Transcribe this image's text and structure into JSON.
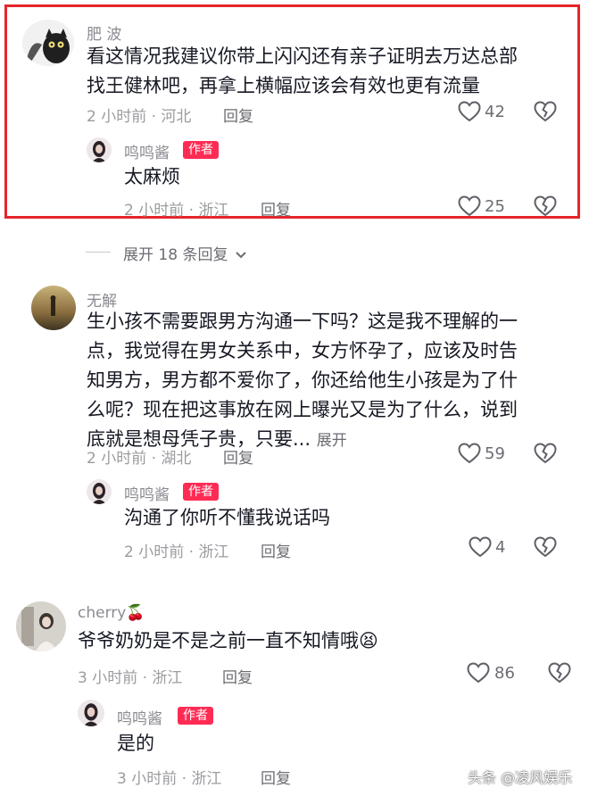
{
  "comments": [
    {
      "username": "肥 波",
      "lines": [
        "看这情况我建议你带上闪闪还有亲子证明去万达总部",
        "找王健林吧，再拿上横幅应该会有效也更有流量"
      ],
      "time_location": "2 小时前 · 河北",
      "reply_label": "回复",
      "likes": "42",
      "reply": {
        "username": "鸣鸣酱",
        "badge": "作者",
        "text": "太麻烦",
        "time_location": "2 小时前 · 浙江",
        "reply_label": "回复",
        "likes": "25"
      }
    },
    {
      "username": "无解",
      "lines": [
        "生小孩不需要跟男方沟通一下吗？这是我不理解的一",
        "点，我觉得在男女关系中，女方怀孕了，应该及时告",
        "知男方，男方都不爱你了，你还给他生小孩是为了什",
        "么呢？现在把这事放在网上曝光又是为了什么，说到",
        "底就是想母凭子贵，只要..."
      ],
      "expand_label": "展开",
      "time_location": "2 小时前 · 湖北",
      "reply_label": "回复",
      "likes": "59",
      "reply": {
        "username": "鸣鸣酱",
        "badge": "作者",
        "text": "沟通了你听不懂我说话吗",
        "time_location": "2 小时前 · 浙江",
        "reply_label": "回复",
        "likes": "4"
      }
    },
    {
      "username": "cherry🍒",
      "text": "爷爷奶奶是不是之前一直不知情哦😫",
      "time_location": "3 小时前 · 浙江",
      "reply_label": "回复",
      "likes": "86",
      "reply": {
        "username": "鸣鸣酱",
        "badge": "作者",
        "text": "是的",
        "time_location": "3 小时前 · 浙江",
        "reply_label": "回复"
      }
    }
  ],
  "expand_replies_label": "展开 18 条回复",
  "watermark": "头条 @凌风娱乐",
  "icons": {
    "like": "heart-outline-icon",
    "dislike": "broken-heart-icon",
    "expand": "chevron-down-icon"
  },
  "colors": {
    "highlight": "#e6252b",
    "author_badge": "#fe2c55"
  }
}
